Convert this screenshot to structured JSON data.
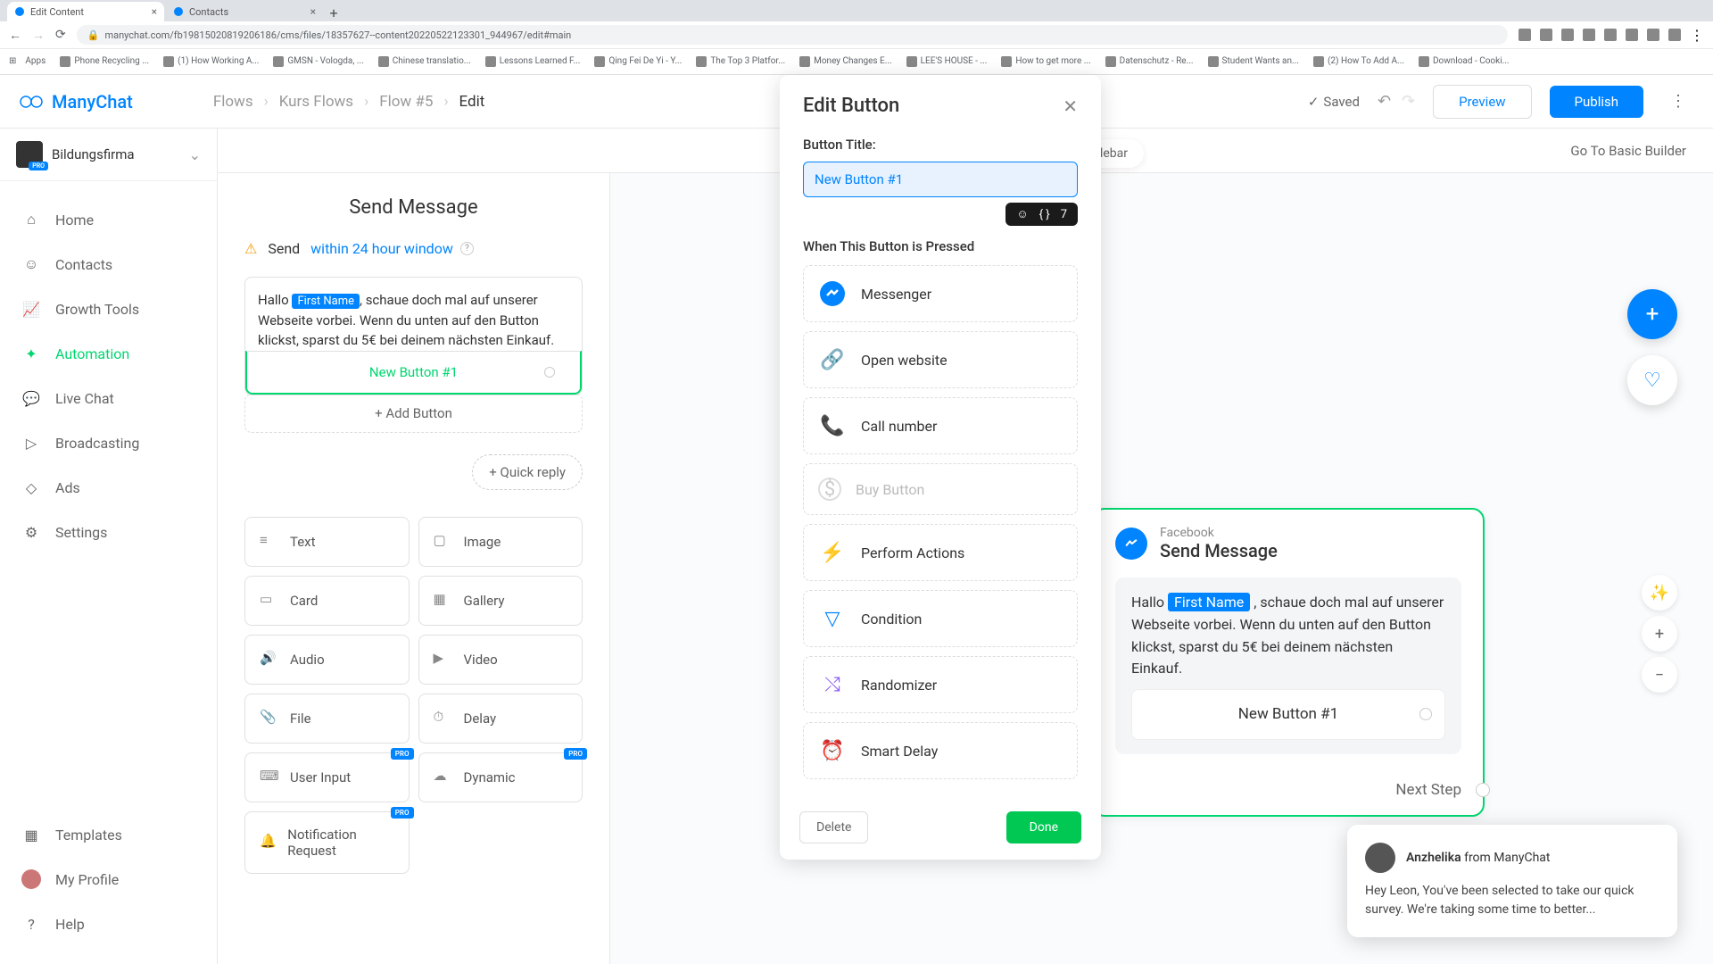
{
  "browser": {
    "tabs": [
      {
        "title": "Edit Content",
        "active": true
      },
      {
        "title": "Contacts",
        "active": false
      }
    ],
    "url": "manychat.com/fb19815020819206186/cms/files/18357627--content20220522123301_944967/edit#main",
    "bookmarks": [
      "Apps",
      "Phone Recycling ...",
      "(1) How Working A...",
      "GMSN - Vologda, ...",
      "Chinese translatio...",
      "Lessons Learned F...",
      "Qing Fei De Yi - Y...",
      "The Top 3 Platfor...",
      "Money Changes E...",
      "LEE'S HOUSE - ...",
      "How to get more ...",
      "Datenschutz - Re...",
      "Student Wants an...",
      "(2) How To Add A...",
      "Download - Cooki..."
    ]
  },
  "brand": "ManyChat",
  "breadcrumb": [
    "Flows",
    "Kurs Flows",
    "Flow #5",
    "Edit"
  ],
  "header": {
    "saved": "Saved",
    "preview": "Preview",
    "publish": "Publish"
  },
  "org": {
    "name": "Bildungsfirma",
    "badge": "PRO"
  },
  "nav": {
    "items": [
      "Home",
      "Contacts",
      "Growth Tools",
      "Automation",
      "Live Chat",
      "Broadcasting",
      "Ads",
      "Settings"
    ],
    "bottom": [
      "Templates",
      "My Profile",
      "Help"
    ],
    "active": "Automation"
  },
  "sub_header": {
    "edit_hint": "Edit step in sidebar",
    "go_basic": "Go To Basic Builder"
  },
  "editor": {
    "title": "Send Message",
    "send_prefix": "Send",
    "send_window": "within 24 hour window",
    "message_prefix": "Hallo ",
    "first_name_tag": "First Name",
    "message_suffix": ", schaue doch mal auf unserer Webseite vorbei. Wenn du unten auf den Button klickst, sparst du 5€ bei deinem nächsten Einkauf.",
    "button_label": "New Button #1",
    "add_button": "+ Add Button",
    "quick_reply": "+ Quick reply",
    "blocks": [
      "Text",
      "Image",
      "Card",
      "Gallery",
      "Audio",
      "Video",
      "File",
      "Delay",
      "User Input",
      "Dynamic",
      "Notification Request"
    ]
  },
  "panel": {
    "title": "Edit Button",
    "field_label": "Button Title:",
    "input_value": "New Button #1",
    "char_count": "7",
    "section": "When This Button is Pressed",
    "options": [
      {
        "label": "Messenger",
        "icon": "messenger",
        "enabled": true
      },
      {
        "label": "Open website",
        "icon": "link",
        "enabled": true
      },
      {
        "label": "Call number",
        "icon": "phone",
        "enabled": true
      },
      {
        "label": "Buy Button",
        "icon": "dollar",
        "enabled": false
      },
      {
        "label": "Perform Actions",
        "icon": "bolt",
        "enabled": true
      },
      {
        "label": "Condition",
        "icon": "filter",
        "enabled": true
      },
      {
        "label": "Randomizer",
        "icon": "shuffle",
        "enabled": true
      },
      {
        "label": "Smart Delay",
        "icon": "clock",
        "enabled": true
      }
    ],
    "delete": "Delete",
    "done": "Done"
  },
  "node": {
    "platform": "Facebook",
    "title": "Send Message",
    "message_prefix": "Hallo ",
    "first_name_tag": "First Name",
    "message_suffix": " , schaue doch mal auf unserer Webseite vorbei. Wenn du unten auf den Button klickst, sparst du 5€ bei deinem nächsten Einkauf.",
    "button": "New Button #1",
    "next_step": "Next Step"
  },
  "chat": {
    "name": "Anzhelika",
    "from": " from ManyChat",
    "text": "Hey Leon,  You've been selected to take our quick survey. We're taking some time to better..."
  }
}
